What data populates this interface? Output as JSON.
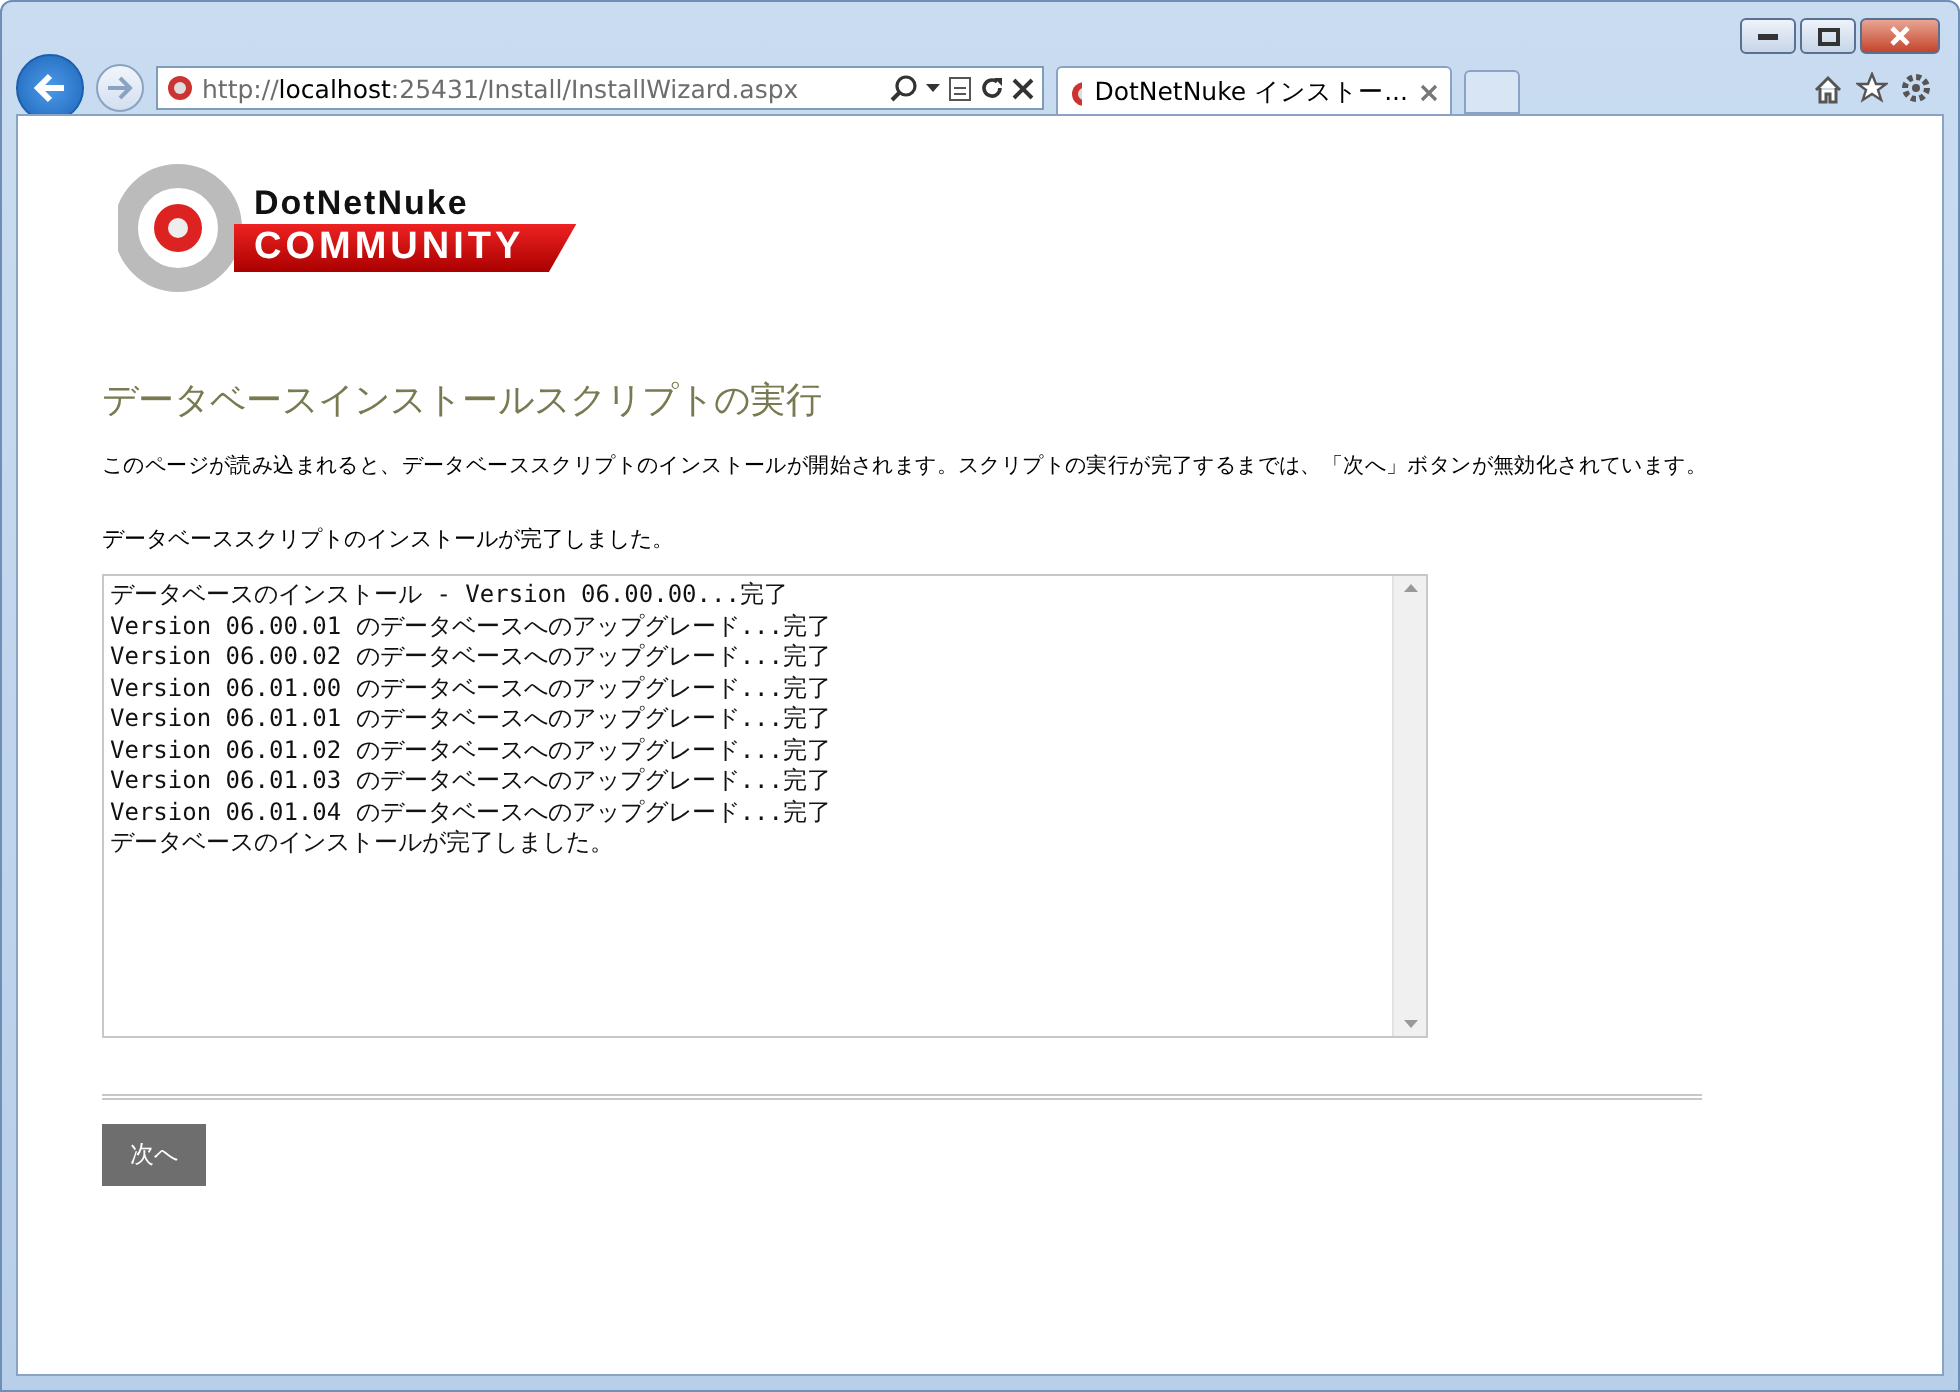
{
  "browser": {
    "url_prefix": "http://",
    "url_host": "localhost",
    "url_rest": ":25431/Install/InstallWizard.aspx",
    "tabs": [
      {
        "label": "DotNetNuke インストー...",
        "selected": true
      }
    ]
  },
  "logo": {
    "title": "DotNetNuke",
    "subtitle": "COMMUNITY"
  },
  "page": {
    "heading": "データベースインストールスクリプトの実行",
    "description": "このページが読み込まれると、データベーススクリプトのインストールが開始されます。スクリプトの実行が完了するまでは、「次へ」ボタンが無効化されています。",
    "status": "データベーススクリプトのインストールが完了しました。",
    "log": [
      "データベースのインストール - Version 06.00.00...完了",
      "Version 06.00.01 のデータベースへのアップグレード...完了",
      "Version 06.00.02 のデータベースへのアップグレード...完了",
      "Version 06.01.00 のデータベースへのアップグレード...完了",
      "Version 06.01.01 のデータベースへのアップグレード...完了",
      "Version 06.01.02 のデータベースへのアップグレード...完了",
      "Version 06.01.03 のデータベースへのアップグレード...完了",
      "Version 06.01.04 のデータベースへのアップグレード...完了",
      "データベースのインストールが完了しました。"
    ],
    "next_button": "次へ"
  }
}
